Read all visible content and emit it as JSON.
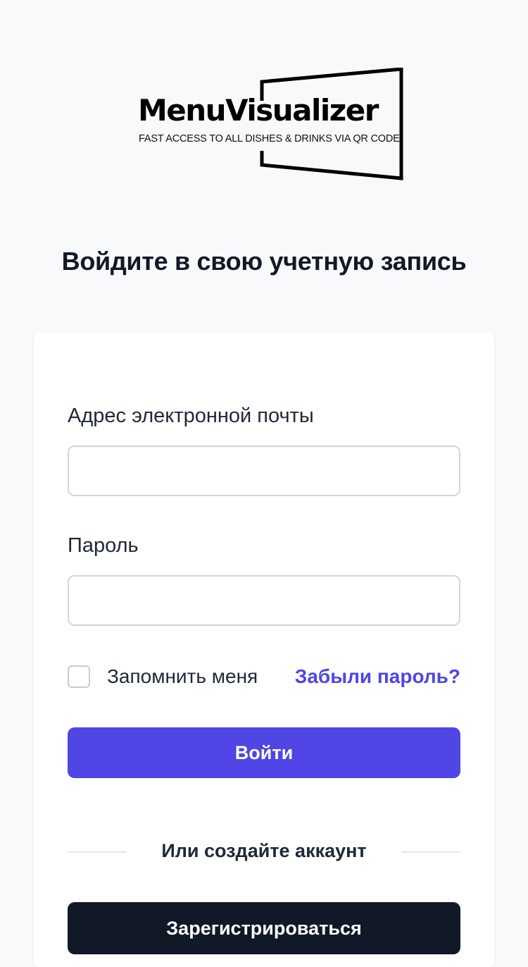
{
  "logo": {
    "name": "MenuVisualizer",
    "tagline": "FAST ACCESS TO ALL DISHES & DRINKS VIA QR CODE"
  },
  "page_title": "Войдите в свою учетную запись",
  "form": {
    "email_label": "Адрес электронной почты",
    "email_value": "",
    "password_label": "Пароль",
    "password_value": "",
    "remember_label": "Запомнить меня",
    "remember_checked": false,
    "forgot_link": "Забыли пароль?",
    "login_button": "Войти",
    "divider_text": "Или создайте аккаунт",
    "register_button": "Зарегистрироваться"
  },
  "colors": {
    "background": "#f8f9fb",
    "accent": "#4f46e5",
    "dark_button": "#111827",
    "text": "#111827"
  }
}
